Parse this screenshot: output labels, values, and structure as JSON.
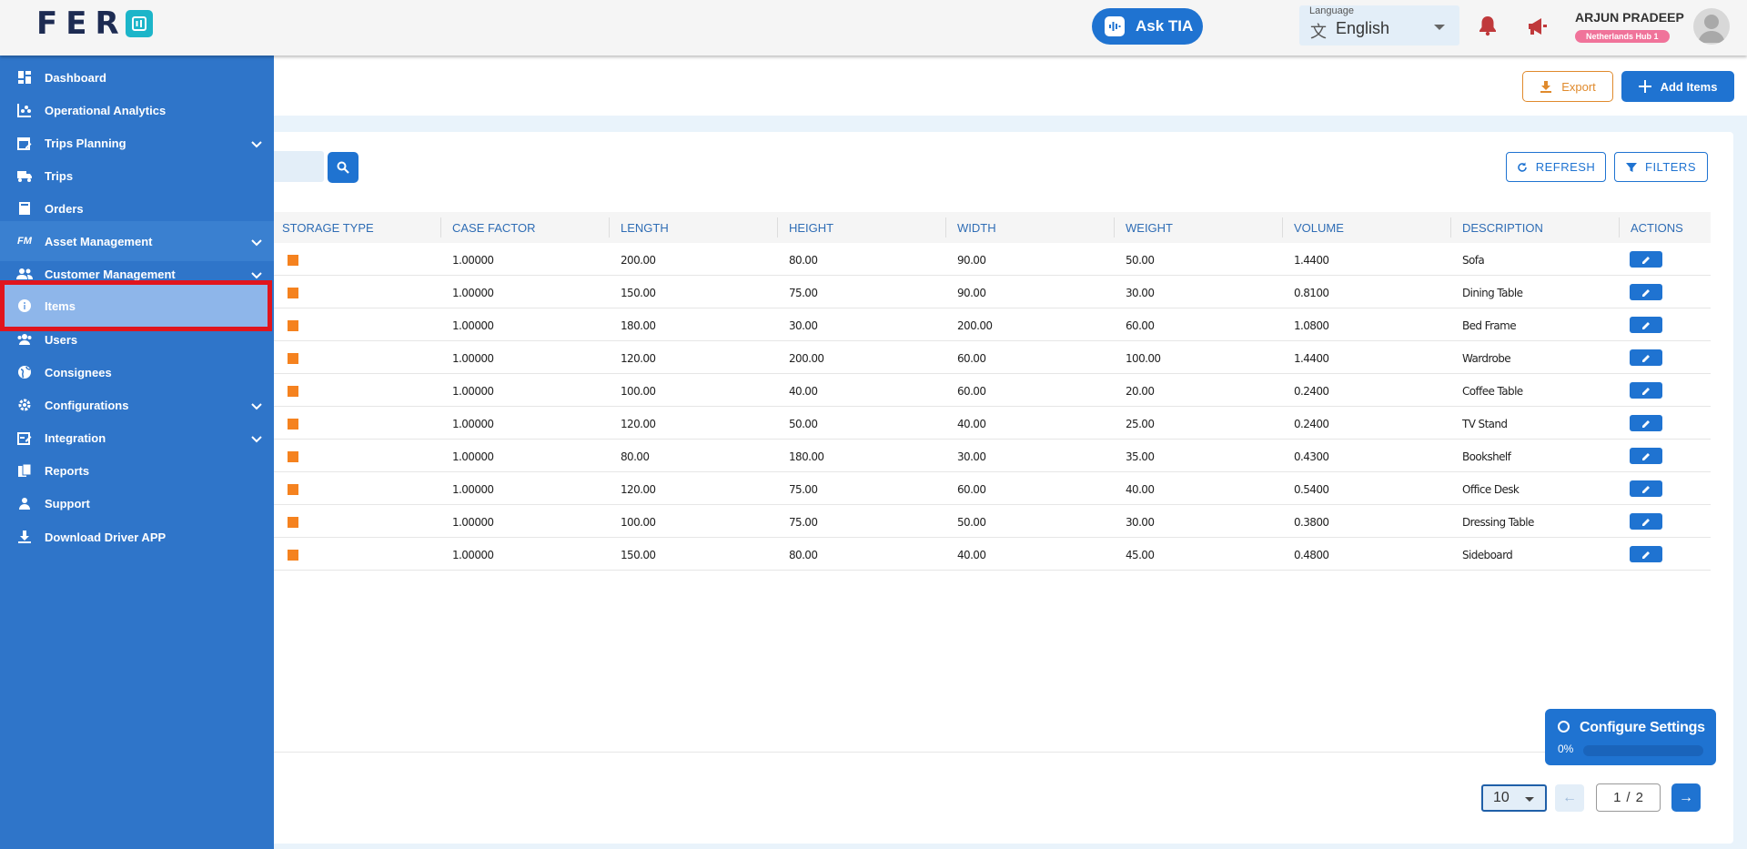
{
  "app": {
    "logo_text": "FER",
    "ask_tia_label": "Ask TIA",
    "language": {
      "label": "Language",
      "value": "English"
    },
    "user": {
      "name": "ARJUN PRADEEP",
      "hub": "Netherlands Hub 1"
    }
  },
  "sidebar": {
    "items": [
      {
        "label": "Dashboard",
        "icon": "dashboard-icon"
      },
      {
        "label": "Operational Analytics",
        "icon": "analytics-icon"
      },
      {
        "label": "Trips Planning",
        "icon": "calendar-edit-icon",
        "expandable": true
      },
      {
        "label": "Trips",
        "icon": "truck-icon"
      },
      {
        "label": "Orders",
        "icon": "inbox-icon"
      },
      {
        "label": "Asset Management",
        "icon": "fm-icon",
        "expandable": true
      },
      {
        "label": "Customer Management",
        "icon": "people-icon",
        "expandable": true
      },
      {
        "label": "Items",
        "icon": "info-icon",
        "active": true
      },
      {
        "label": "Users",
        "icon": "users-icon"
      },
      {
        "label": "Consignees",
        "icon": "globe-icon"
      },
      {
        "label": "Configurations",
        "icon": "gear-icon",
        "expandable": true
      },
      {
        "label": "Integration",
        "icon": "integration-icon",
        "expandable": true
      },
      {
        "label": "Reports",
        "icon": "reports-icon"
      },
      {
        "label": "Support",
        "icon": "support-icon"
      },
      {
        "label": "Download Driver APP",
        "icon": "download-icon"
      }
    ],
    "fm_glyph": "FM"
  },
  "toolbar": {
    "export_label": "Export",
    "add_items_label": "Add Items",
    "refresh_label": "REFRESH",
    "filters_label": "FILTERS"
  },
  "table": {
    "columns": [
      "STORAGE TYPE",
      "CASE FACTOR",
      "LENGTH",
      "HEIGHT",
      "WIDTH",
      "WEIGHT",
      "VOLUME",
      "DESCRIPTION",
      "ACTIONS"
    ],
    "storage_color": "#f5821f",
    "rows": [
      {
        "case_factor": "1.00000",
        "length": "200.00",
        "height": "80.00",
        "width": "90.00",
        "weight": "50.00",
        "volume": "1.4400",
        "description": "Sofa"
      },
      {
        "case_factor": "1.00000",
        "length": "150.00",
        "height": "75.00",
        "width": "90.00",
        "weight": "30.00",
        "volume": "0.8100",
        "description": "Dining Table"
      },
      {
        "case_factor": "1.00000",
        "length": "180.00",
        "height": "30.00",
        "width": "200.00",
        "weight": "60.00",
        "volume": "1.0800",
        "description": "Bed Frame"
      },
      {
        "case_factor": "1.00000",
        "length": "120.00",
        "height": "200.00",
        "width": "60.00",
        "weight": "100.00",
        "volume": "1.4400",
        "description": "Wardrobe"
      },
      {
        "case_factor": "1.00000",
        "length": "100.00",
        "height": "40.00",
        "width": "60.00",
        "weight": "20.00",
        "volume": "0.2400",
        "description": "Coffee Table"
      },
      {
        "case_factor": "1.00000",
        "length": "120.00",
        "height": "50.00",
        "width": "40.00",
        "weight": "25.00",
        "volume": "0.2400",
        "description": "TV Stand"
      },
      {
        "case_factor": "1.00000",
        "length": "80.00",
        "height": "180.00",
        "width": "30.00",
        "weight": "35.00",
        "volume": "0.4300",
        "description": "Bookshelf"
      },
      {
        "case_factor": "1.00000",
        "length": "120.00",
        "height": "75.00",
        "width": "60.00",
        "weight": "40.00",
        "volume": "0.5400",
        "description": "Office Desk"
      },
      {
        "case_factor": "1.00000",
        "length": "100.00",
        "height": "75.00",
        "width": "50.00",
        "weight": "30.00",
        "volume": "0.3800",
        "description": "Dressing Table"
      },
      {
        "case_factor": "1.00000",
        "length": "150.00",
        "height": "80.00",
        "width": "40.00",
        "weight": "45.00",
        "volume": "0.4800",
        "description": "Sideboard"
      }
    ]
  },
  "pagination": {
    "page_size": "10",
    "current_page": "1",
    "separator": "/",
    "total_pages": "2"
  },
  "configure_settings": {
    "title": "Configure Settings",
    "progress_label": "0%",
    "progress": 0
  },
  "colors": {
    "primary": "#1f73d1",
    "sidebar": "#2f75c9",
    "export_accent": "#e08a2c",
    "highlight_outline": "#e0151d"
  }
}
